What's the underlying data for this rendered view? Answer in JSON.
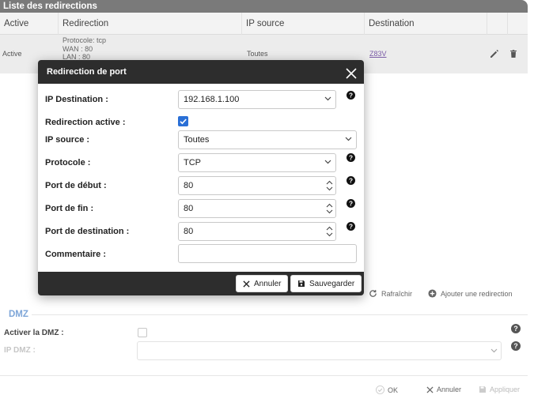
{
  "list": {
    "title": "Liste des redirections",
    "columns": [
      "Active",
      "Redirection",
      "IP source",
      "Destination"
    ],
    "row": {
      "active": "Active",
      "redirection_lines": [
        "Protocole: tcp",
        "WAN : 80",
        "LAN : 80"
      ],
      "ip_source": "Toutes",
      "destination": "Z83V"
    }
  },
  "actions": {
    "refresh": "Rafraîchir",
    "add": "Ajouter une redirection"
  },
  "dmz": {
    "title": "DMZ",
    "enable_label": "Activer la DMZ :",
    "ip_label": "IP DMZ :"
  },
  "footer": {
    "ok": "OK",
    "cancel": "Annuler",
    "apply": "Appliquer"
  },
  "modal": {
    "title": "Redirection de port",
    "fields": {
      "ip_destination": {
        "label": "IP Destination :",
        "value": "192.168.1.100"
      },
      "active": {
        "label": "Redirection active :",
        "checked": true
      },
      "ip_source": {
        "label": "IP source :",
        "value": "Toutes"
      },
      "protocol": {
        "label": "Protocole :",
        "value": "TCP"
      },
      "port_start": {
        "label": "Port de début :",
        "value": "80"
      },
      "port_end": {
        "label": "Port de fin :",
        "value": "80"
      },
      "port_dest": {
        "label": "Port de destination :",
        "value": "80"
      },
      "comment": {
        "label": "Commentaire :",
        "value": ""
      }
    },
    "buttons": {
      "cancel": "Annuler",
      "save": "Sauvegarder"
    }
  },
  "colors": {
    "header_bg": "#7a7a7a",
    "modal_bar": "#2d2d2d",
    "checkbox": "#2a6fd6",
    "dmz_title": "#7ea6d8",
    "link": "#7a5ba6"
  }
}
